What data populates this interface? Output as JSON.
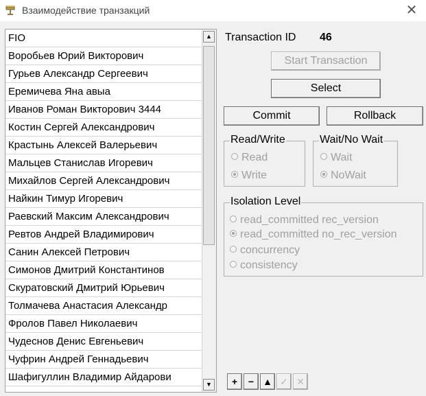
{
  "window": {
    "title": "Взаимодействие транзакций"
  },
  "grid": {
    "column_header": "FIO",
    "rows": [
      "Воробьев Юрий Викторович",
      "Гурьев Александр Сергеевич",
      "Еремичева Яна авыа",
      "Иванов Роман Викторович 3444",
      "Костин Сергей Александрович",
      "Крастынь Алексей Валерьевич",
      "Мальцев Станислав Игоревич",
      "Михайлов Сергей Александрович",
      "Найкин Тимур Игоревич",
      "Раевский Максим Александрович",
      "Ревтов Андрей Владимирович",
      "Санин Алексей Петрович",
      "Симонов Дмитрий Константинов",
      "Скуратовский Дмитрий Юрьевич",
      "Толмачева Анастасия Александр",
      "Фролов Павел Николаевич",
      "Чудеснов Денис Евгеньевич",
      "Чуфрин Андрей Геннадьевич",
      "Шафигуллин Владимир Айдарови"
    ]
  },
  "transaction": {
    "label": "Transaction ID",
    "value": "46"
  },
  "buttons": {
    "start_transaction": "Start Transaction",
    "select": "Select",
    "commit": "Commit",
    "rollback": "Rollback"
  },
  "read_write": {
    "title": "Read/Write",
    "options": [
      "Read",
      "Write"
    ],
    "selected": "Write"
  },
  "wait": {
    "title": "Wait/No Wait",
    "options": [
      "Wait",
      "NoWait"
    ],
    "selected": "NoWait"
  },
  "isolation": {
    "title": "Isolation Level",
    "options": [
      "read_committed rec_version",
      "read_committed no_rec_version",
      "concurrency",
      "consistency"
    ],
    "selected": "read_committed no_rec_version"
  },
  "navigator": {
    "add": "+",
    "delete": "−",
    "up": "▲",
    "post": "✓",
    "cancel": "✕"
  },
  "icons": {
    "app": "database-icon",
    "close": "close-icon"
  }
}
